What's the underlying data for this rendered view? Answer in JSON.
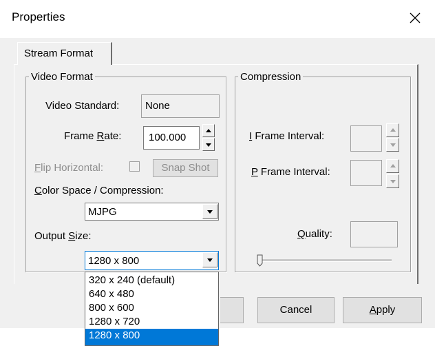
{
  "window": {
    "title": "Properties",
    "close_icon": "close-icon"
  },
  "tabs": [
    {
      "label": "Stream Format",
      "selected": true
    }
  ],
  "video_format": {
    "group_title": "Video Format",
    "video_standard_label": "Video Standard:",
    "video_standard_value": "None",
    "frame_rate_label_pre": "Frame ",
    "frame_rate_label_mnemonic": "R",
    "frame_rate_label_post": "ate:",
    "frame_rate_value": "100.000",
    "flip_horizontal_mnemonic": "F",
    "flip_horizontal_label_rest": "lip Horizontal:",
    "snap_shot_label": "Snap Shot",
    "color_space_mnemonic": "C",
    "color_space_label_rest": "olor Space / Compression:",
    "color_space_value": "MJPG",
    "output_size_label_pre": "Output ",
    "output_size_mnemonic": "S",
    "output_size_label_post": "ize:",
    "output_size_value": "1280 x 800"
  },
  "compression": {
    "group_title": "Compression",
    "i_frame_mnemonic": "I",
    "i_frame_label_rest": " Frame Interval:",
    "p_frame_mnemonic": "P",
    "p_frame_label_rest": " Frame Interval:",
    "quality_mnemonic": "Q",
    "quality_label_rest": "uality:"
  },
  "output_size_options": [
    {
      "label": "320 x 240  (default)",
      "selected": false
    },
    {
      "label": "640 x 480",
      "selected": false
    },
    {
      "label": "800 x 600",
      "selected": false
    },
    {
      "label": "1280 x 720",
      "selected": false
    },
    {
      "label": "1280 x 800",
      "selected": true
    }
  ],
  "buttons": {
    "cancel_label": "Cancel",
    "apply_mnemonic": "A",
    "apply_label_rest": "pply"
  },
  "colors": {
    "selection": "#0078d7",
    "dialog_bg": "#f0f0f0",
    "disabled_text": "#8d8d8d"
  }
}
